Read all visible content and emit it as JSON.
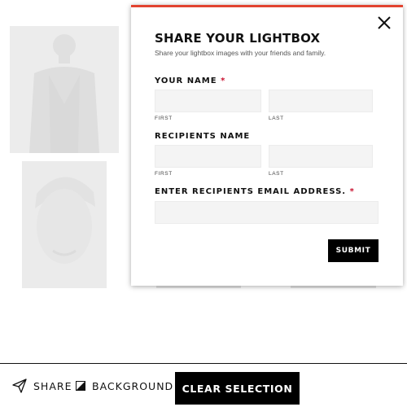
{
  "modal": {
    "title": "SHARE YOUR LIGHTBOX",
    "subtitle": "Share your lightbox images with your friends and family.",
    "your_name": {
      "label": "YOUR NAME",
      "required_mark": "*",
      "first_sublabel": "FIRST",
      "last_sublabel": "LAST",
      "first_value": "",
      "last_value": ""
    },
    "recipients_name": {
      "label": "RECIPIENTS NAME",
      "first_sublabel": "FIRST",
      "last_sublabel": "LAST",
      "first_value": "",
      "last_value": ""
    },
    "email": {
      "label": "ENTER RECIPIENTS EMAIL ADDRESS.",
      "required_mark": "*",
      "value": ""
    },
    "submit_label": "SUBMIT",
    "close_icon": "close-icon"
  },
  "toolbar": {
    "share_label": "SHARE",
    "share_icon": "paper-plane-icon",
    "background_label": "BACKGROUND",
    "background_icon": "contrast-icon",
    "clear_label": "CLEAR SELECTION"
  },
  "colors": {
    "accent_top_border": "#e2432f",
    "required_mark": "#c8102e",
    "button_bg": "#000000",
    "button_text": "#ffffff",
    "input_bg": "#f4f4f4"
  }
}
